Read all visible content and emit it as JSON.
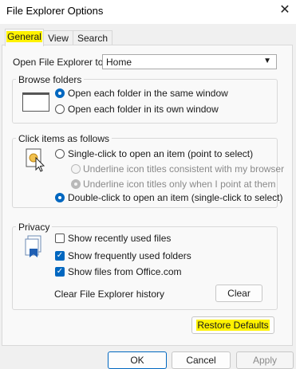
{
  "window": {
    "title": "File Explorer Options",
    "close_glyph": "✕"
  },
  "tabs": [
    {
      "label": "General",
      "active": true
    },
    {
      "label": "View",
      "active": false
    },
    {
      "label": "Search",
      "active": false
    }
  ],
  "general": {
    "open_label": "Open File Explorer to:",
    "open_value": "Home",
    "browse": {
      "title": "Browse folders",
      "options": [
        {
          "label": "Open each folder in the same window",
          "selected": true
        },
        {
          "label": "Open each folder in its own window",
          "selected": false
        }
      ]
    },
    "click": {
      "title": "Click items as follows",
      "options": [
        {
          "label": "Single-click to open an item (point to select)",
          "selected": false
        },
        {
          "label": "Underline icon titles consistent with my browser",
          "selected": false,
          "disabled": true
        },
        {
          "label": "Underline icon titles only when I point at them",
          "selected": true,
          "disabled": true
        },
        {
          "label": "Double-click to open an item (single-click to select)",
          "selected": true
        }
      ]
    },
    "privacy": {
      "title": "Privacy",
      "options": [
        {
          "label": "Show recently used files",
          "checked": false
        },
        {
          "label": "Show frequently used folders",
          "checked": true
        },
        {
          "label": "Show files from Office.com",
          "checked": true
        }
      ],
      "clear_label": "Clear File Explorer history",
      "clear_button": "Clear"
    },
    "restore_button": "Restore Defaults"
  },
  "footer": {
    "ok": "OK",
    "cancel": "Cancel",
    "apply": "Apply"
  },
  "colors": {
    "accent": "#0067c0",
    "highlight": "#fff200"
  }
}
